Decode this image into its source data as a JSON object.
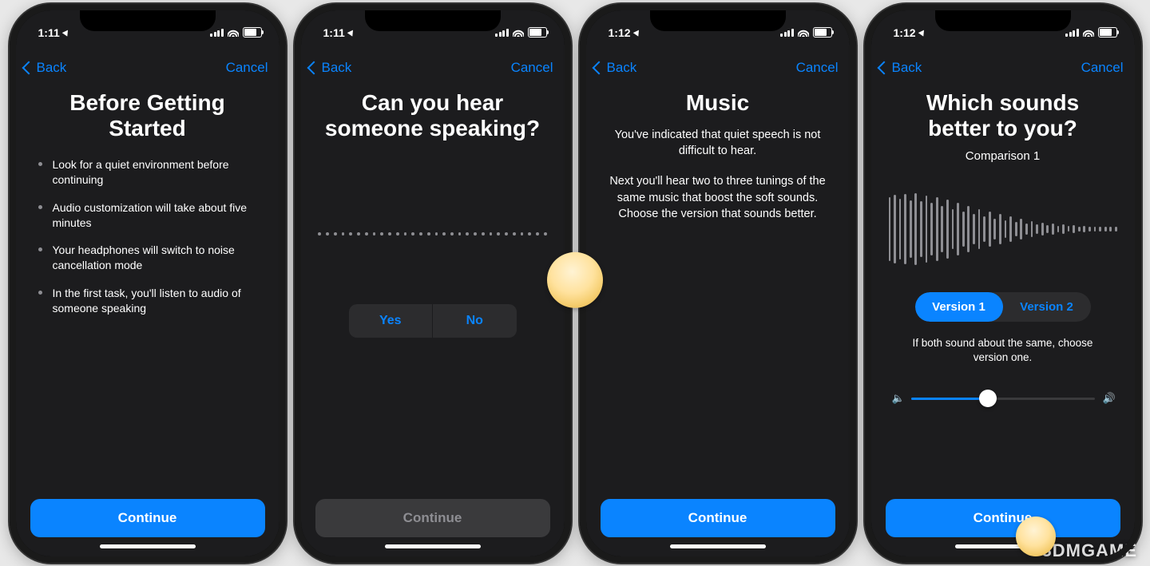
{
  "screens": [
    {
      "time": "1:11",
      "nav": {
        "back": "Back",
        "cancel": "Cancel"
      },
      "title": "Before Getting Started",
      "bullets": [
        "Look for a quiet environment before continuing",
        "Audio customization will take about five minutes",
        "Your headphones will switch to noise cancellation mode",
        "In the first task, you'll listen to audio of someone speaking"
      ],
      "continue_label": "Continue",
      "continue_enabled": true
    },
    {
      "time": "1:11",
      "nav": {
        "back": "Back",
        "cancel": "Cancel"
      },
      "title": "Can you hear someone speaking?",
      "yes_label": "Yes",
      "no_label": "No",
      "continue_label": "Continue",
      "continue_enabled": false
    },
    {
      "time": "1:12",
      "nav": {
        "back": "Back",
        "cancel": "Cancel"
      },
      "title": "Music",
      "paragraphs": [
        "You've indicated that quiet speech is not difficult to hear.",
        "Next you'll hear two to three tunings of the same music that boost the soft sounds. Choose the version that sounds better."
      ],
      "continue_label": "Continue",
      "continue_enabled": true
    },
    {
      "time": "1:12",
      "nav": {
        "back": "Back",
        "cancel": "Cancel"
      },
      "title": "Which sounds better to you?",
      "comparison_label": "Comparison 1",
      "version1_label": "Version 1",
      "version2_label": "Version 2",
      "selected_version": 1,
      "hint": "If both sound about the same, choose version one.",
      "volume_percent": 42,
      "continue_label": "Continue",
      "continue_enabled": true
    }
  ],
  "watermark": "3DMGAME"
}
